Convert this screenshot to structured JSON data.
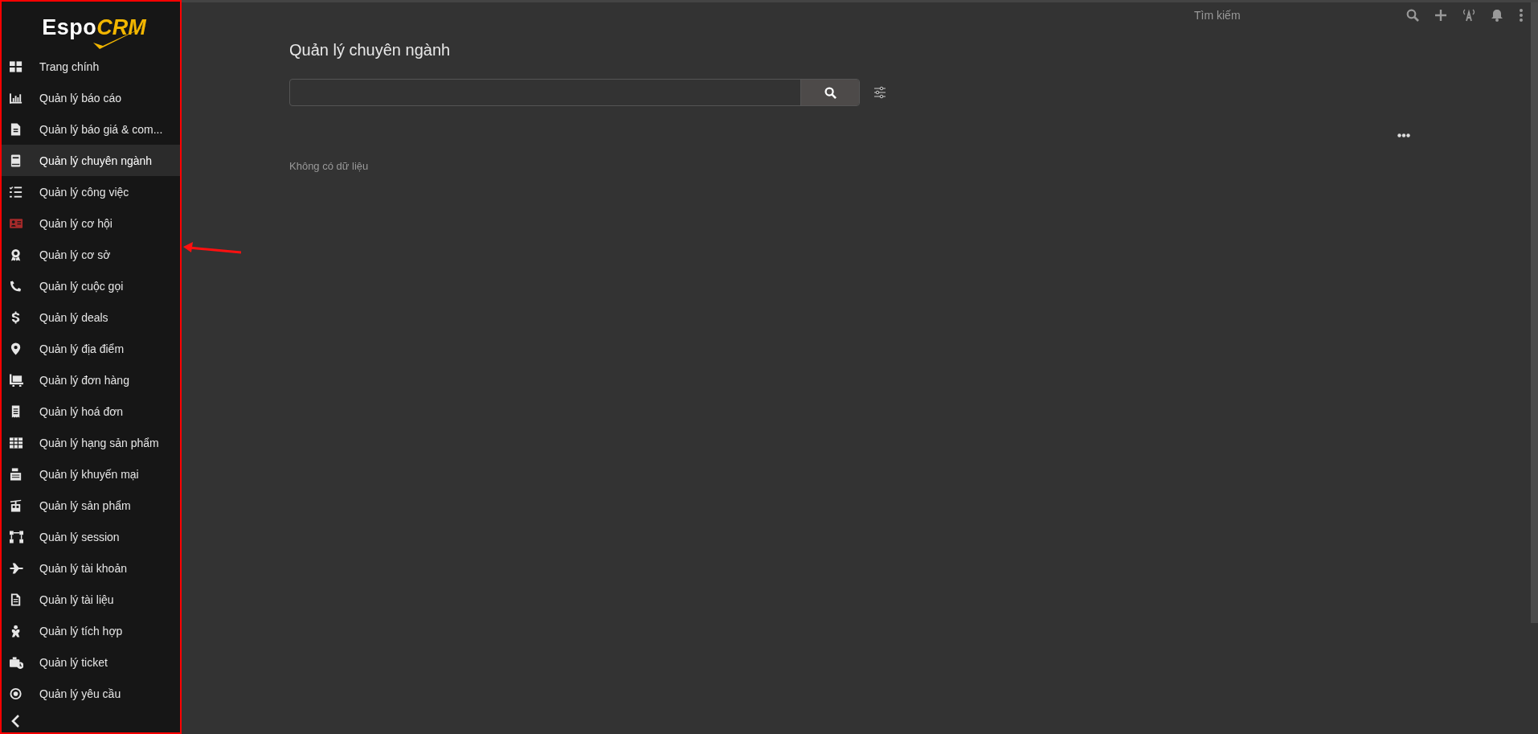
{
  "logo": {
    "part_1": "Espo",
    "part_2": "CRM"
  },
  "sidebar": {
    "items": [
      {
        "label": "Trang chính",
        "selected": false
      },
      {
        "label": "Quản lý báo cáo",
        "selected": false
      },
      {
        "label": "Quản lý báo giá & com...",
        "selected": false
      },
      {
        "label": "Quản lý chuyên ngành",
        "selected": true
      },
      {
        "label": "Quản lý công việc",
        "selected": false
      },
      {
        "label": "Quản lý cơ hội",
        "selected": false
      },
      {
        "label": "Quản lý cơ sở",
        "selected": false
      },
      {
        "label": "Quản lý cuộc gọi",
        "selected": false
      },
      {
        "label": "Quản lý deals",
        "selected": false
      },
      {
        "label": "Quản lý địa điểm",
        "selected": false
      },
      {
        "label": "Quản lý đơn hàng",
        "selected": false
      },
      {
        "label": "Quản lý hoá đơn",
        "selected": false
      },
      {
        "label": "Quản lý hạng sản phẩm",
        "selected": false
      },
      {
        "label": "Quản lý khuyến mại",
        "selected": false
      },
      {
        "label": "Quản lý sản phẩm",
        "selected": false
      },
      {
        "label": "Quản lý session",
        "selected": false
      },
      {
        "label": "Quản lý tài khoản",
        "selected": false
      },
      {
        "label": "Quản lý tài liệu",
        "selected": false
      },
      {
        "label": "Quản lý tích hợp",
        "selected": false
      },
      {
        "label": "Quản lý ticket",
        "selected": false
      },
      {
        "label": "Quản lý yêu cầu",
        "selected": false
      }
    ]
  },
  "topbar": {
    "search_placeholder": "Tìm kiếm"
  },
  "page": {
    "title": "Quản lý chuyên ngành",
    "empty_message": "Không có dữ liệu"
  }
}
